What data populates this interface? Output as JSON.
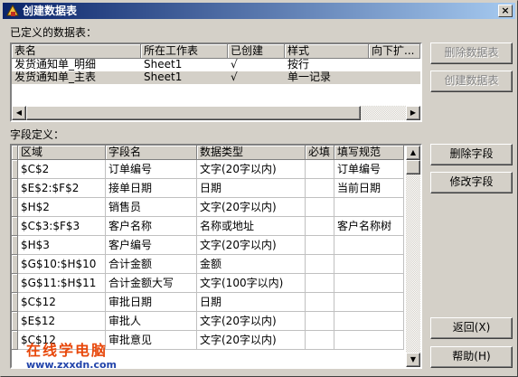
{
  "window": {
    "title": "创建数据表",
    "close": "×"
  },
  "defined_tables": {
    "label": "已定义的数据表：",
    "columns": [
      "表名",
      "所在工作表",
      "已创建",
      "样式",
      "向下扩..."
    ],
    "rows": [
      [
        "发货通知单_明细",
        "Sheet1",
        "√",
        "按行",
        ""
      ],
      [
        "发货通知单_主表",
        "Sheet1",
        "√",
        "单一记录",
        ""
      ]
    ]
  },
  "fields": {
    "label": "字段定义：",
    "columns": [
      "区域",
      "字段名",
      "数据类型",
      "必填",
      "填写规范"
    ],
    "rows": [
      [
        "$C$2",
        "订单编号",
        "文字(20字以内)",
        "",
        "订单编号"
      ],
      [
        "$E$2:$F$2",
        "接单日期",
        "日期",
        "",
        "当前日期"
      ],
      [
        "$H$2",
        "销售员",
        "文字(20字以内)",
        "",
        ""
      ],
      [
        "$C$3:$F$3",
        "客户名称",
        "名称或地址",
        "",
        "客户名称树"
      ],
      [
        "$H$3",
        "客户编号",
        "文字(20字以内)",
        "",
        ""
      ],
      [
        "$G$10:$H$10",
        "合计金额",
        "金额",
        "",
        ""
      ],
      [
        "$G$11:$H$11",
        "合计金额大写",
        "文字(100字以内)",
        "",
        ""
      ],
      [
        "$C$12",
        "审批日期",
        "日期",
        "",
        ""
      ],
      [
        "$E$12",
        "审批人",
        "文字(20字以内)",
        "",
        ""
      ],
      [
        "$C$12",
        "审批意见",
        "文字(20字以内)",
        "",
        ""
      ]
    ]
  },
  "buttons": {
    "delete_table": "删除数据表",
    "create_table": "创建数据表",
    "delete_field": "删除字段",
    "modify_field": "修改字段",
    "back": "返回(X)",
    "help": "帮助(H)"
  },
  "watermark": {
    "line1": "在线学电脑",
    "line2": "www.zxxdn.com"
  },
  "colors": {
    "title_start": "#0a246a",
    "title_end": "#a6caf0",
    "face": "#d4d0c8",
    "watermark": "#e8470a"
  }
}
